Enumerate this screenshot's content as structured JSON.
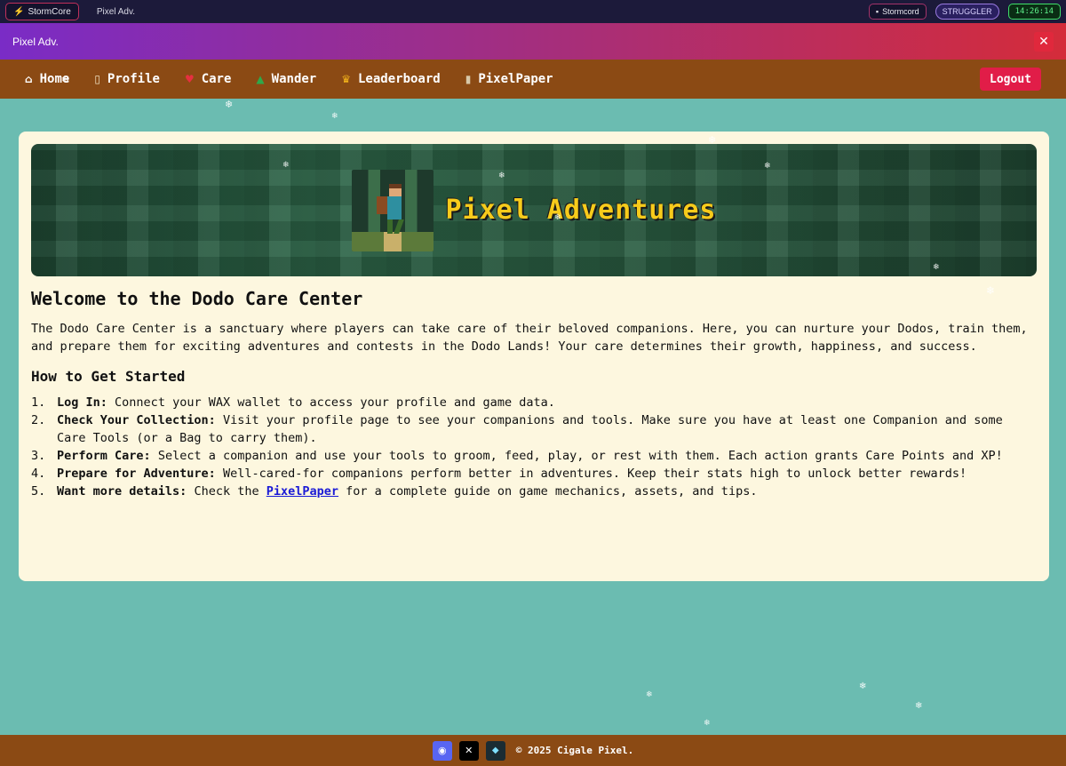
{
  "system_bar": {
    "app_tab": "StormCore",
    "window_title": "Pixel Adv.",
    "stormcord_label": "Stormcord",
    "status_badge": "STRUGGLER",
    "clock": "14:26:14"
  },
  "app_header": {
    "title": "Pixel Adv.",
    "close_symbol": "✕"
  },
  "nav": {
    "items": [
      {
        "label": "Home",
        "icon": "home-icon"
      },
      {
        "label": "Profile",
        "icon": "profile-icon"
      },
      {
        "label": "Care",
        "icon": "heart-icon"
      },
      {
        "label": "Wander",
        "icon": "tree-icon"
      },
      {
        "label": "Leaderboard",
        "icon": "trophy-icon"
      },
      {
        "label": "PixelPaper",
        "icon": "scroll-icon"
      }
    ],
    "logout_label": "Logout"
  },
  "banner": {
    "title": "Pixel Adventures"
  },
  "content": {
    "heading": "Welcome to the Dodo Care Center",
    "intro": "The Dodo Care Center is a sanctuary where players can take care of their beloved companions. Here, you can nurture your Dodos, train them, and prepare them for exciting adventures and contests in the Dodo Lands! Your care determines their growth, happiness, and success.",
    "subheading": "How to Get Started",
    "steps": [
      {
        "num": "1.",
        "title": "Log In:",
        "text": "Connect your WAX wallet to access your profile and game data."
      },
      {
        "num": "2.",
        "title": "Check Your Collection:",
        "text": "Visit your profile page to see your companions and tools. Make sure you have at least one Companion and some Care Tools (or a Bag to carry them)."
      },
      {
        "num": "3.",
        "title": "Perform Care:",
        "text": "Select a companion and use your tools to groom, feed, play, or rest with them. Each action grants Care Points and XP!"
      },
      {
        "num": "4.",
        "title": "Prepare for Adventure:",
        "text": "Well-cared-for companions perform better in adventures. Keep their stats high to unlock better rewards!"
      },
      {
        "num": "5.",
        "title": "Want more details:",
        "text_before": "Check the",
        "link": "PixelPaper",
        "text_after": "for a complete guide on game mechanics, assets, and tips."
      }
    ]
  },
  "footer": {
    "copyright": "© 2025 Cigale Pixel.",
    "socials": [
      "discord-icon",
      "x-icon",
      "neftyblocks-icon"
    ]
  },
  "colors": {
    "background": "#6bbcb1",
    "nav": "#8b4a14",
    "card": "#fdf7df",
    "logout": "#e11d48",
    "banner_title": "#f7cb1b",
    "link": "#1a1ad6"
  }
}
